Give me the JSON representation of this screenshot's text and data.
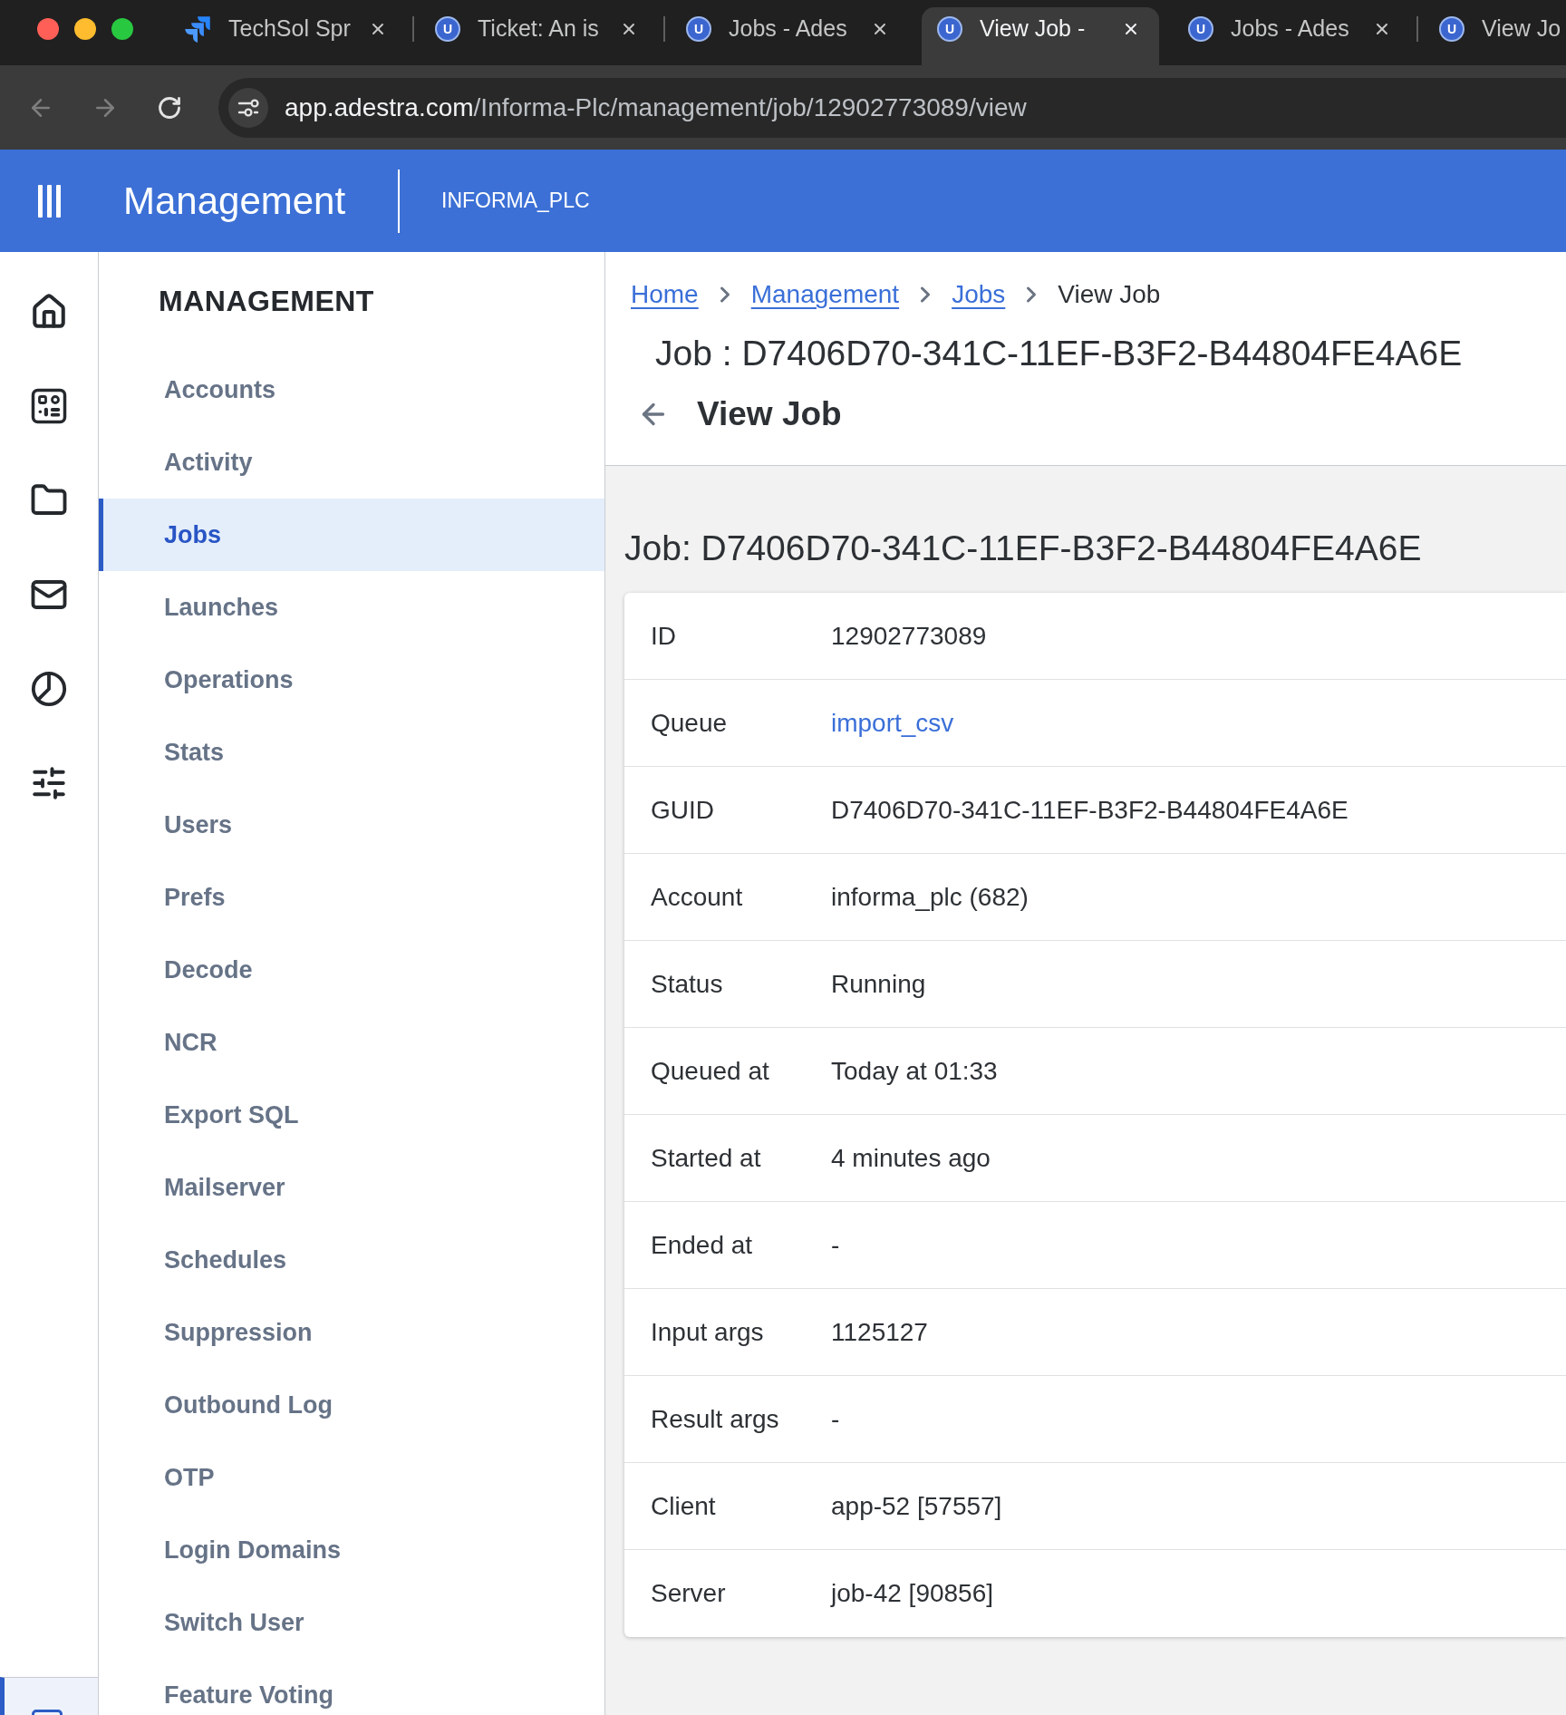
{
  "browser": {
    "tabs": [
      {
        "kind": "logo",
        "title": "TechSol Spr",
        "selected": false
      },
      {
        "kind": "letter",
        "icon_text": "U",
        "title": "Ticket: An is",
        "selected": false
      },
      {
        "kind": "letter",
        "icon_text": "U",
        "title": "Jobs - Ades",
        "selected": false
      },
      {
        "kind": "letter",
        "icon_text": "U",
        "title": "View Job -",
        "selected": true
      },
      {
        "kind": "letter",
        "icon_text": "U",
        "title": "Jobs - Ades",
        "selected": false
      },
      {
        "kind": "letter",
        "icon_text": "U",
        "title": "View Jo",
        "selected": false
      }
    ],
    "toolbar": {
      "back": {
        "disabled": true
      },
      "forward": {
        "disabled": true
      },
      "url_host": "app.adestra.com",
      "url_path": "/Informa-Plc/management/job/12902773089/view"
    }
  },
  "app_header": {
    "title": "Management",
    "account": "INFORMA_PLC"
  },
  "rail": [
    {
      "selected": false
    },
    {
      "selected": false
    },
    {
      "selected": false
    },
    {
      "selected": false
    },
    {
      "selected": false
    },
    {
      "selected": false
    },
    {
      "selected": true
    }
  ],
  "sidebar": {
    "heading": "MANAGEMENT",
    "items": [
      {
        "label": "Accounts",
        "selected": false
      },
      {
        "label": "Activity",
        "selected": false
      },
      {
        "label": "Jobs",
        "selected": true
      },
      {
        "label": "Launches",
        "selected": false
      },
      {
        "label": "Operations",
        "selected": false
      },
      {
        "label": "Stats",
        "selected": false
      },
      {
        "label": "Users",
        "selected": false
      },
      {
        "label": "Prefs",
        "selected": false
      },
      {
        "label": "Decode",
        "selected": false
      },
      {
        "label": "NCR",
        "selected": false
      },
      {
        "label": "Export SQL",
        "selected": false
      },
      {
        "label": "Mailserver",
        "selected": false
      },
      {
        "label": "Schedules",
        "selected": false
      },
      {
        "label": "Suppression",
        "selected": false
      },
      {
        "label": "Outbound Log",
        "selected": false
      },
      {
        "label": "OTP",
        "selected": false
      },
      {
        "label": "Login Domains",
        "selected": false
      },
      {
        "label": "Switch User",
        "selected": false
      },
      {
        "label": "Feature Voting",
        "selected": false
      }
    ]
  },
  "breadcrumb": [
    {
      "label": "Home",
      "link": true
    },
    {
      "label": "Management",
      "link": true
    },
    {
      "label": "Jobs",
      "link": true
    },
    {
      "label": "View Job",
      "link": false
    }
  ],
  "page": {
    "title": "Job : D7406D70-341C-11EF-B3F2-B44804FE4A6E",
    "subtitle": "View Job"
  },
  "details": {
    "heading": "Job: D7406D70-341C-11EF-B3F2-B44804FE4A6E",
    "rows": [
      {
        "label": "ID",
        "value": "12902773089",
        "link": false
      },
      {
        "label": "Queue",
        "value": "import_csv",
        "link": true
      },
      {
        "label": "GUID",
        "value": "D7406D70-341C-11EF-B3F2-B44804FE4A6E",
        "link": false
      },
      {
        "label": "Account",
        "value": "informa_plc (682)",
        "link": false
      },
      {
        "label": "Status",
        "value": "Running",
        "link": false
      },
      {
        "label": "Queued at",
        "value": "Today at 01:33",
        "link": false
      },
      {
        "label": "Started at",
        "value": "4 minutes ago",
        "link": false
      },
      {
        "label": "Ended at",
        "value": "-",
        "link": false
      },
      {
        "label": "Input args",
        "value": "1125127",
        "link": false
      },
      {
        "label": "Result args",
        "value": "-",
        "link": false
      },
      {
        "label": "Client",
        "value": "app-52 [57557]",
        "link": false
      },
      {
        "label": "Server",
        "value": "job-42 [90856]",
        "link": false
      }
    ]
  }
}
